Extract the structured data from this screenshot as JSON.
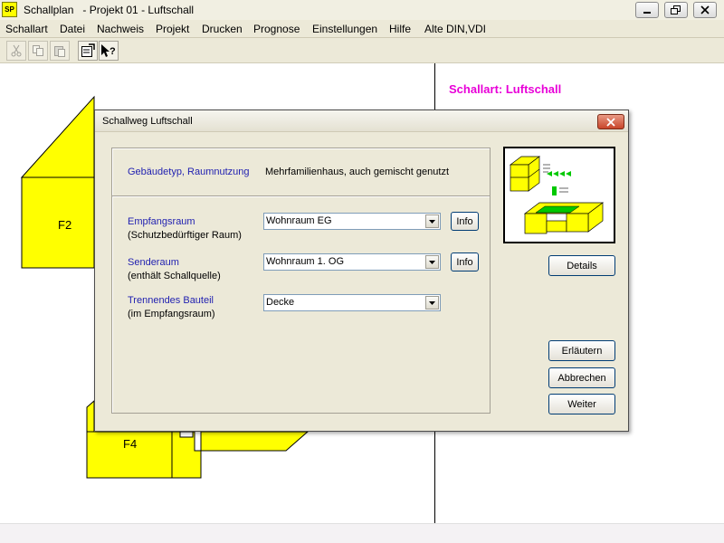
{
  "app": {
    "icon_text": "SP",
    "title": "Schallplan   - Projekt 01 - Luftschall"
  },
  "menu": [
    "Schallart",
    "Datei",
    "Nachweis",
    "Projekt",
    "Drucken",
    "Prognose",
    "Einstellungen",
    "Hilfe",
    "Alte DIN,VDI"
  ],
  "toolbar": {
    "icons": [
      "cut-icon",
      "copy-icon",
      "paste-icon",
      "properties-icon",
      "context-help-icon"
    ]
  },
  "canvas": {
    "floor_labels": [
      "F2",
      "F4"
    ],
    "right_heading": "Schallart: Luftschall",
    "floor_color": "#ffff00"
  },
  "dialog": {
    "title": "Schallweg Luftschall",
    "building_label": "Gebäudetyp, Raumnutzung",
    "building_value": "Mehrfamilienhaus, auch gemischt genutzt",
    "receiving_label": "Empfangsraum",
    "receiving_sub": "(Schutzbedürftiger Raum)",
    "receiving_value": "Wohnraum EG",
    "source_label": "Senderaum",
    "source_sub": "(enthält Schallquelle)",
    "source_value": "Wohnraum 1. OG",
    "component_label": "Trennendes Bauteil",
    "component_sub": "(im Empfangsraum)",
    "component_value": "Decke",
    "info_label": "Info",
    "details_label": "Details",
    "explain_label": "Erläutern",
    "cancel_label": "Abbrechen",
    "next_label": "Weiter",
    "accent_color": "#1f1fb0"
  }
}
